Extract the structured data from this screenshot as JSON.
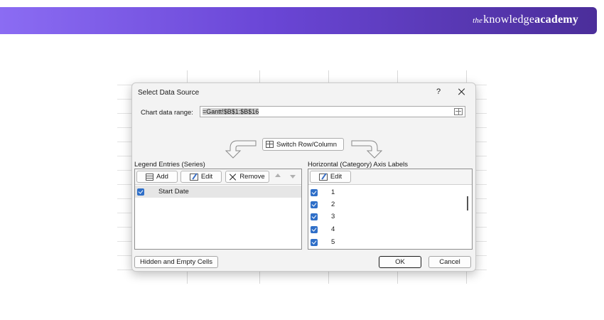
{
  "brand": {
    "prefix": "the",
    "word1": "knowledge",
    "word2": "academy"
  },
  "dialog": {
    "title": "Select Data Source",
    "help": "?",
    "range_label": "Chart data range:",
    "range_value": "=Gantt!$B$1:$B$16",
    "switch_label": "Switch Row/Column",
    "legend": {
      "title": "Legend Entries (Series)",
      "add_label": "Add",
      "edit_label": "Edit",
      "remove_label": "Remove",
      "entries": [
        {
          "label": "Start Date",
          "checked": true
        }
      ]
    },
    "axis": {
      "title": "Horizontal (Category) Axis Labels",
      "edit_label": "Edit",
      "entries": [
        {
          "label": "1",
          "checked": true
        },
        {
          "label": "2",
          "checked": true
        },
        {
          "label": "3",
          "checked": true
        },
        {
          "label": "4",
          "checked": true
        },
        {
          "label": "5",
          "checked": true
        }
      ]
    },
    "hidden_cells_label": "Hidden and Empty Cells",
    "ok_label": "OK",
    "cancel_label": "Cancel"
  },
  "colors": {
    "banner_start": "#8b6cf3",
    "banner_end": "#4b2e9a",
    "checkbox": "#2f6fc8"
  }
}
